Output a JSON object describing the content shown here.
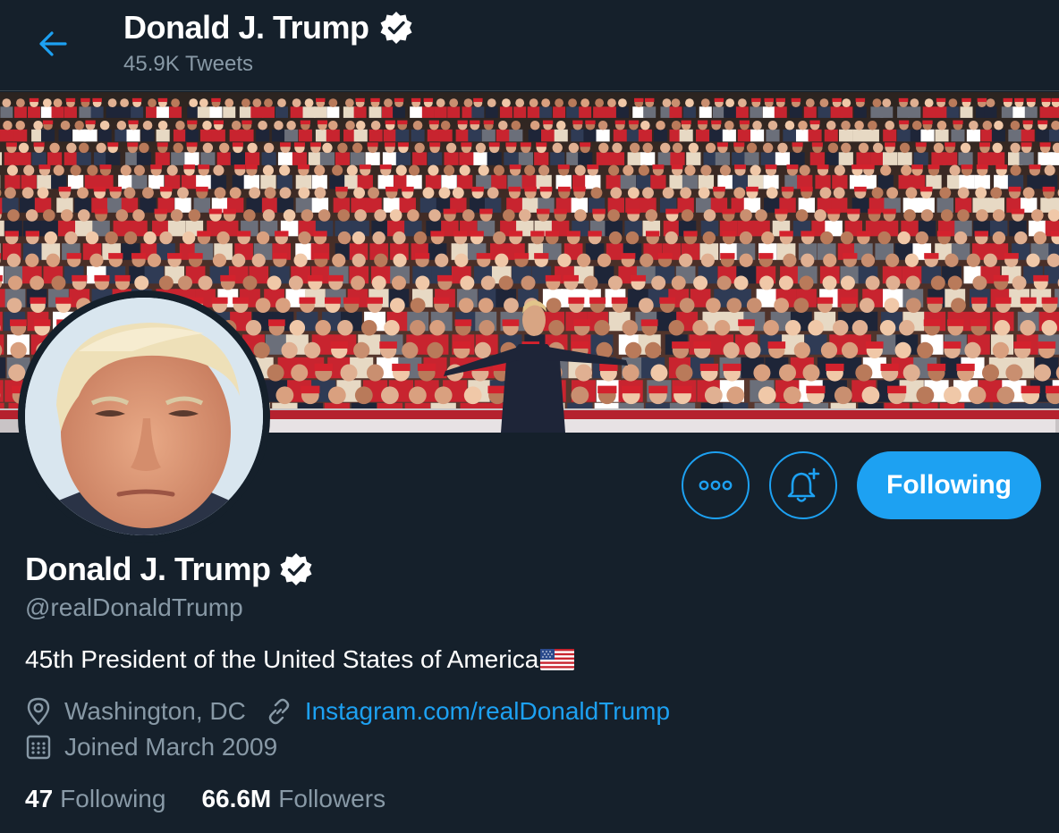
{
  "header": {
    "title": "Donald J. Trump",
    "tweet_count": "45.9K Tweets",
    "back_icon": "arrow-left-icon"
  },
  "colors": {
    "background": "#15202b",
    "accent": "#1da1f2",
    "muted_text": "#8899a6",
    "divider": "#38444d"
  },
  "actions": {
    "more_icon": "more-icon",
    "notify_icon": "bell-plus-icon",
    "follow_label": "Following"
  },
  "profile": {
    "name": "Donald J. Trump",
    "handle": "@realDonaldTrump",
    "bio": "45th President of the United States of America",
    "bio_emoji": "us-flag-icon",
    "location": "Washington, DC",
    "website": "Instagram.com/realDonaldTrump",
    "joined": "Joined March 2009"
  },
  "stats": {
    "following_count": "47",
    "following_label": "Following",
    "followers_count": "66.6M",
    "followers_label": "Followers"
  }
}
